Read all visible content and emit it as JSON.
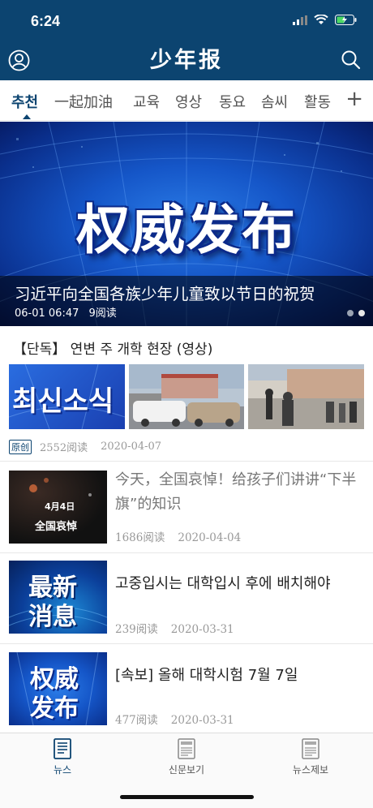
{
  "status": {
    "time": "6:24"
  },
  "header": {
    "title": "少年报"
  },
  "tabs": [
    {
      "label": "추천"
    },
    {
      "label": "一起加油"
    },
    {
      "label": "교육"
    },
    {
      "label": "영상"
    },
    {
      "label": "동요"
    },
    {
      "label": "솜씨"
    },
    {
      "label": "활동"
    }
  ],
  "tab_add_label": "+",
  "banner": {
    "image_text": "权威发布",
    "headline": "习近平向全国各族少年儿童致以节日的祝贺",
    "datetime": "06-01 06:47",
    "reads": "9阅读"
  },
  "featured": {
    "title": "【단독】 연변 주 개학 현장 (영상)",
    "image1_text": "최신소식",
    "tag": "原创",
    "reads": "2552阅读",
    "date": "2020-04-07"
  },
  "articles": [
    {
      "title": "今天，全国哀悼！给孩子们讲讲“下半旗”的知识",
      "thumb_line1": "4月4日",
      "thumb_line2": "全国哀悼",
      "reads": "1686阅读",
      "date": "2020-04-04"
    },
    {
      "title": "고중입시는 대학입시 후에 배치해야",
      "thumb_line1": "最新",
      "thumb_line2": "消息",
      "reads": "239阅读",
      "date": "2020-03-31"
    },
    {
      "title": "[속보] 올해 대학시험 7월 7일",
      "thumb_line1": "权威",
      "thumb_line2": "发布",
      "reads": "477阅读",
      "date": "2020-03-31"
    }
  ],
  "bottom_nav": [
    {
      "label": "뉴스",
      "icon": "news-icon"
    },
    {
      "label": "신문보기",
      "icon": "newspaper-icon"
    },
    {
      "label": "뉴스제보",
      "icon": "report-news-icon"
    }
  ],
  "colors": {
    "brand": "#0c4470",
    "banner_blue": "#1556c8"
  }
}
